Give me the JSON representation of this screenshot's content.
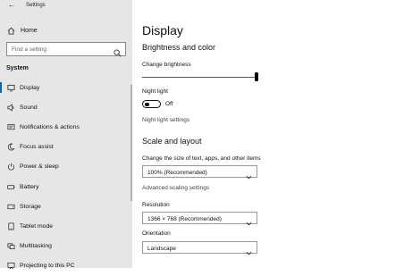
{
  "window": {
    "title": "Settings"
  },
  "sidebar": {
    "home_label": "Home",
    "search_placeholder": "Find a setting",
    "section_label": "System",
    "items": [
      {
        "label": "Display",
        "icon": "monitor-icon",
        "selected": true
      },
      {
        "label": "Sound",
        "icon": "speaker-icon"
      },
      {
        "label": "Notifications & actions",
        "icon": "notification-icon"
      },
      {
        "label": "Focus assist",
        "icon": "moon-icon"
      },
      {
        "label": "Power & sleep",
        "icon": "power-icon"
      },
      {
        "label": "Battery",
        "icon": "battery-icon"
      },
      {
        "label": "Storage",
        "icon": "storage-icon"
      },
      {
        "label": "Tablet mode",
        "icon": "tablet-icon"
      },
      {
        "label": "Multitasking",
        "icon": "multitasking-icon"
      },
      {
        "label": "Projecting to this PC",
        "icon": "projecting-icon"
      }
    ]
  },
  "main": {
    "title": "Display",
    "brightness": {
      "heading": "Brightness and color",
      "slider_label": "Change brightness",
      "brightness_level": 1.0
    },
    "night_light": {
      "label": "Night light",
      "state": "Off",
      "settings_link": "Night light settings"
    },
    "scale": {
      "heading": "Scale and layout",
      "size_label": "Change the size of text, apps, and other items",
      "size_value": "100% (Recommended)",
      "advanced_link": "Advanced scaling settings",
      "resolution_label": "Resolution",
      "resolution_value": "1366 × 768 (Recommended)",
      "orientation_label": "Orientation",
      "orientation_value": "Landscape"
    }
  },
  "colors": {
    "accent": "#0067c0",
    "sidebar_bg": "#e6e6e6"
  }
}
